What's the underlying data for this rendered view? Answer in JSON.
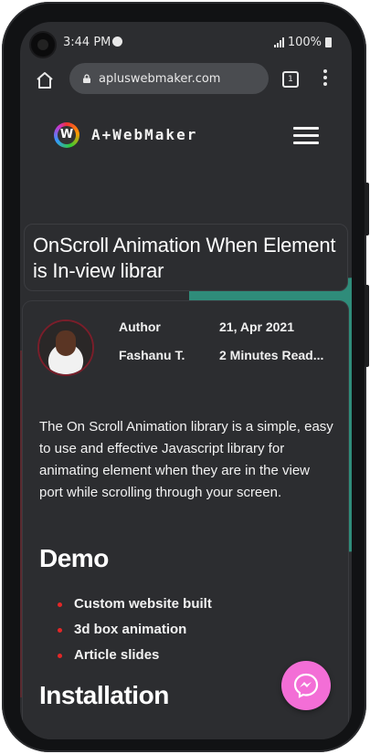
{
  "status": {
    "time": "3:44 PM",
    "battery": "100%"
  },
  "browser": {
    "url": "apluswebmaker.com",
    "tab_count": "1"
  },
  "site": {
    "brand": "A+WebMaker",
    "logo_letter": "W"
  },
  "article": {
    "title": "OnScroll Animation When Element is In-view librar",
    "author_label": "Author",
    "author_name": "Fashanu T.",
    "date": "21, Apr 2021",
    "read_time": "2 Minutes Read...",
    "intro": "The On Scroll Animation library is a simple, easy to use and effective Javascript library for animating element when they are in the view port while scrolling through your screen.",
    "demo_heading": "Demo",
    "demo_items": [
      "Custom website built",
      "3d box animation",
      "Article slides"
    ],
    "install_heading": "Installation"
  },
  "colors": {
    "teal_accent": "#2f8c7a",
    "messenger": "#f36ed6",
    "bullet": "#e32727"
  }
}
